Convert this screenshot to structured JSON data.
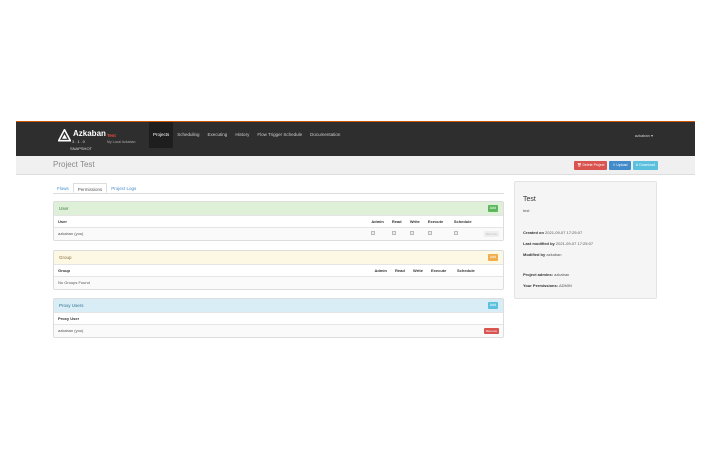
{
  "app": {
    "name": "Azkaban",
    "version": "3.1.0",
    "build": "SNAPSHOT",
    "env_name": "Test",
    "env_desc": "My Local Azkaban"
  },
  "nav": {
    "items": [
      {
        "label": "Projects",
        "active": true
      },
      {
        "label": "Scheduling",
        "active": false
      },
      {
        "label": "Executing",
        "active": false
      },
      {
        "label": "History",
        "active": false
      },
      {
        "label": "Flow Trigger Schedule",
        "active": false
      },
      {
        "label": "Documentation",
        "active": false
      }
    ],
    "user": "azkaban"
  },
  "header": {
    "title": "Project Test",
    "delete_label": "Delete Project",
    "upload_label": "Upload",
    "download_label": "Download"
  },
  "tabs": [
    {
      "label": "Flows",
      "active": false
    },
    {
      "label": "Permissions",
      "active": true
    },
    {
      "label": "Project Logs",
      "active": false
    }
  ],
  "user_panel": {
    "title": "User",
    "add_label": "Add",
    "columns": [
      "User",
      "Admin",
      "Read",
      "Write",
      "Execute",
      "Schedule"
    ],
    "rows": [
      {
        "name": "azkaban (you)",
        "remove_label": "Remove"
      }
    ]
  },
  "group_panel": {
    "title": "Group",
    "add_label": "Add",
    "columns": [
      "Group",
      "Admin",
      "Read",
      "Write",
      "Execute",
      "Schedule"
    ],
    "empty": "No Groups Found"
  },
  "proxy_panel": {
    "title": "Proxy Users",
    "add_label": "Add",
    "column": "Proxy User",
    "rows": [
      {
        "name": "azkaban (you)",
        "remove_label": "Remove"
      }
    ]
  },
  "project_info": {
    "name": "Test",
    "description": "test",
    "created_label": "Created on",
    "created_value": "2021-09-07 17:25:07",
    "modified_label": "Last modified by",
    "modified_value": "2021-09-07 17:25:07",
    "modified_by_label": "Modified by",
    "modified_by_value": "azkaban",
    "admins_label": "Project admins:",
    "admins_value": "azkaban",
    "perms_label": "Your Permissions:",
    "perms_value": "ADMIN"
  },
  "colors": {
    "topbar": "#2e2e2e",
    "accent": "#d35400",
    "danger": "#d9534f",
    "primary": "#428bca",
    "info": "#5bc0de"
  }
}
